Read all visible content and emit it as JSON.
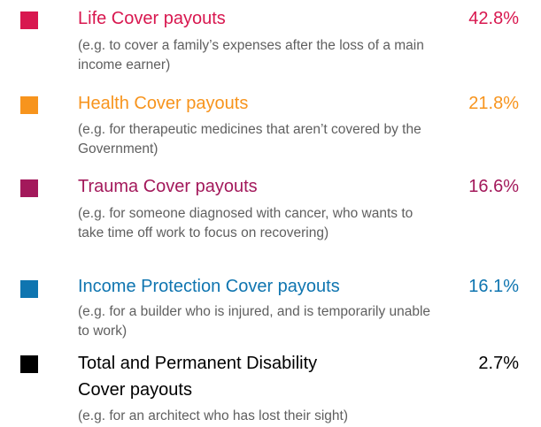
{
  "chart_data": {
    "type": "table",
    "items": [
      {
        "label": "Life Cover payouts",
        "value": "42.8%",
        "percent": 42.8,
        "description": "(e.g. to cover a family’s expenses after the loss of a main income earner)",
        "color": "#d8174f"
      },
      {
        "label": "Health Cover payouts",
        "value": "21.8%",
        "percent": 21.8,
        "description": "(e.g. for therapeutic medicines that aren’t covered by the Government)",
        "color": "#f7941d"
      },
      {
        "label": "Trauma Cover payouts",
        "value": "16.6%",
        "percent": 16.6,
        "description": "(e.g. for someone diagnosed with cancer, who wants to take time off work to focus on recovering)",
        "color": "#a3195b"
      },
      {
        "label": "Income Protection Cover payouts",
        "value": "16.1%",
        "percent": 16.1,
        "description": "(e.g. for a builder who is injured, and is temporarily unable to work)",
        "color": "#0f75b0"
      },
      {
        "label": "Total and Permanent Disability Cover payouts",
        "label_lines": [
          "Total and Permanent Disability",
          "Cover payouts"
        ],
        "value": "2.7%",
        "percent": 2.7,
        "description": "(e.g. for an architect who has lost their sight)",
        "color": "#000000"
      }
    ]
  }
}
